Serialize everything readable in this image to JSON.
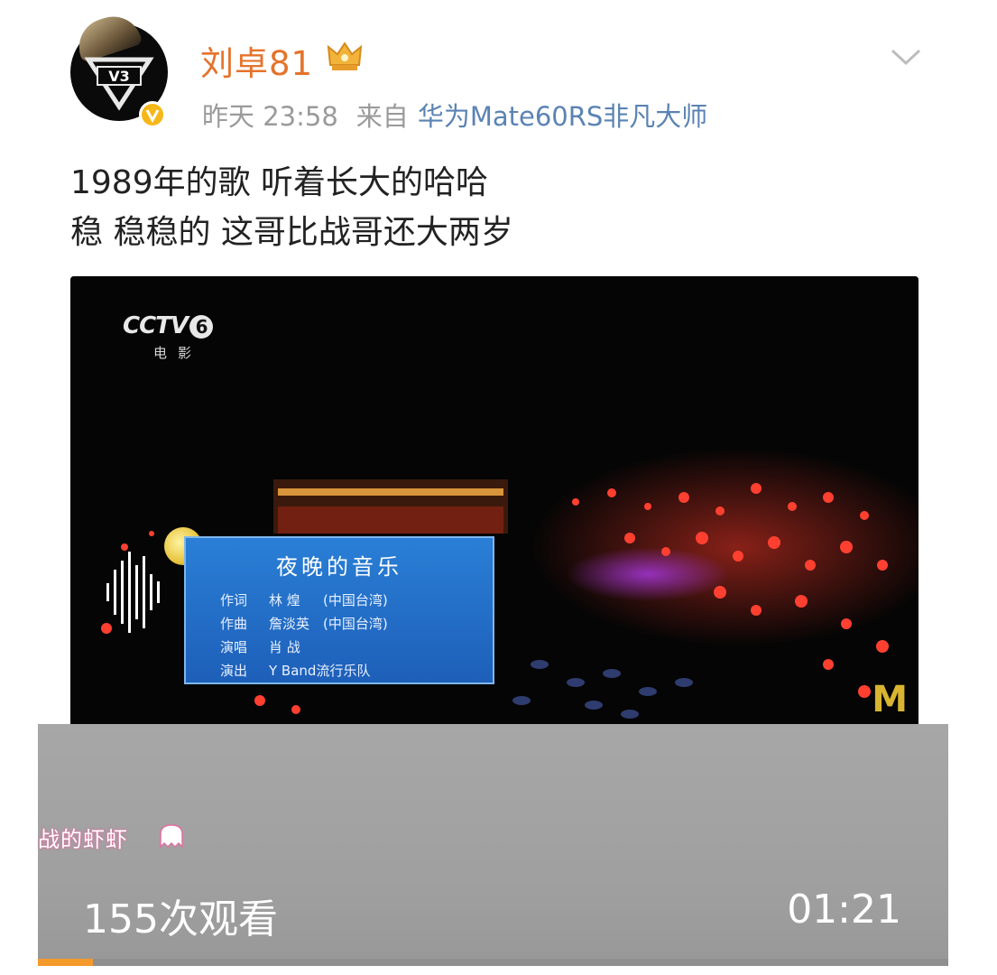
{
  "post": {
    "username": "刘卓81",
    "time": "昨天 23:58",
    "source_prefix": "来自",
    "source": "华为Mate60RS非凡大师",
    "text_lines": [
      "1989年的歌 听着长大的哈哈",
      "稳 稳稳的 这哥比战哥还大两岁"
    ]
  },
  "icons": {
    "avatar": "avatar-v3-logo",
    "verified": "verified-badge-icon",
    "crown": "crown-icon",
    "more": "chevron-down-icon"
  },
  "video": {
    "channel_logo": "CCTV",
    "channel_number": "6",
    "channel_sub": "电影",
    "caption_title": "夜晚的音乐",
    "caption_rows": [
      {
        "k": "作词",
        "v": "林 煌",
        "r": "(中国台湾)"
      },
      {
        "k": "作曲",
        "v": "詹淡英",
        "r": "(中国台湾)"
      },
      {
        "k": "演唱",
        "v": "肖 战",
        "r": ""
      },
      {
        "k": "演出",
        "v": "Y Band流行乐队",
        "r": ""
      }
    ],
    "views": "155次观看",
    "duration": "01:21",
    "progress_fraction": 0.06,
    "watermark": "战的虾虾"
  },
  "colors": {
    "username": "#e5732b",
    "source": "#5b83b3",
    "progress": "#f39a2b",
    "caption_bg": "#2a7fd6"
  }
}
